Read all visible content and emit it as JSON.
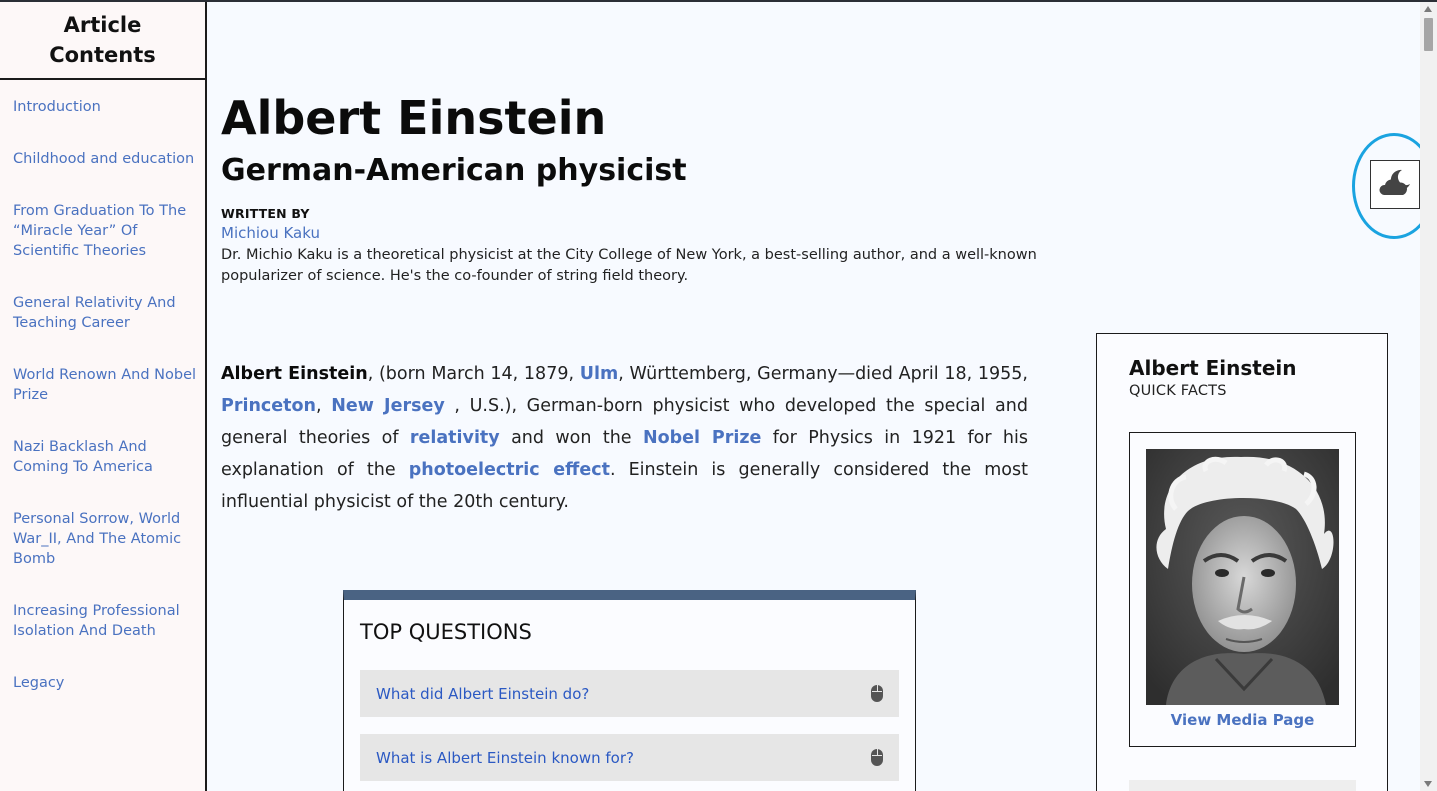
{
  "sidebar": {
    "title": "Article Contents",
    "items": [
      {
        "label": "Introduction"
      },
      {
        "label": "Childhood and education"
      },
      {
        "label": "From Graduation To The “Miracle Year” Of Scientific Theories"
      },
      {
        "label": "General Relativity And Teaching Career"
      },
      {
        "label": "World Renown And Nobel Prize"
      },
      {
        "label": "Nazi Backlash And Coming To America"
      },
      {
        "label": "Personal Sorrow, World War_II, And The Atomic Bomb"
      },
      {
        "label": "Increasing Professional Isolation And Death"
      },
      {
        "label": "Legacy"
      }
    ]
  },
  "article": {
    "title": "Albert Einstein",
    "subtitle": "German-American physicist",
    "written_by_label": "WRITTEN BY",
    "author": "Michiou Kaku",
    "author_bio": "Dr. Michio Kaku is a theoretical physicist at the City College of New York, a best-selling author, and a well-known popularizer of science. He's the co-founder of string field theory.",
    "lead": {
      "name": "Albert Einstein",
      "t1": ", (born March 14, 1879, ",
      "link_ulm": "Ulm",
      "t2": ", Württemberg, Germany—died April 18, 1955, ",
      "link_princeton": "Princeton",
      "t3": ", ",
      "link_nj": "New Jersey",
      "t4": " , U.S.), German-born physicist who developed the special and general theories of ",
      "link_relativity": "relativity",
      "t5": " and won the ",
      "link_nobel": "Nobel Prize",
      "t6": " for Physics in 1921 for his explanation of the ",
      "link_photo": "photoelectric effect",
      "t7": ". Einstein is generally considered the most influential physicist of the 20th century."
    }
  },
  "top_questions": {
    "title": "TOP QUESTIONS",
    "items": [
      {
        "question": "What did Albert Einstein do?"
      },
      {
        "question": "What is Albert Einstein known for?"
      }
    ]
  },
  "quick_facts": {
    "name": "Albert Einstein",
    "subtitle": "QUICK FACTS",
    "media_link": "View Media Page"
  },
  "icons": {
    "theme_toggle": "cloud-moon-icon",
    "question_toggle": "mouse-icon"
  },
  "colors": {
    "link": "#4a72c0",
    "question_link": "#2b59c3",
    "highlight": "#1aa3e0",
    "tq_border": "#4a6383"
  }
}
